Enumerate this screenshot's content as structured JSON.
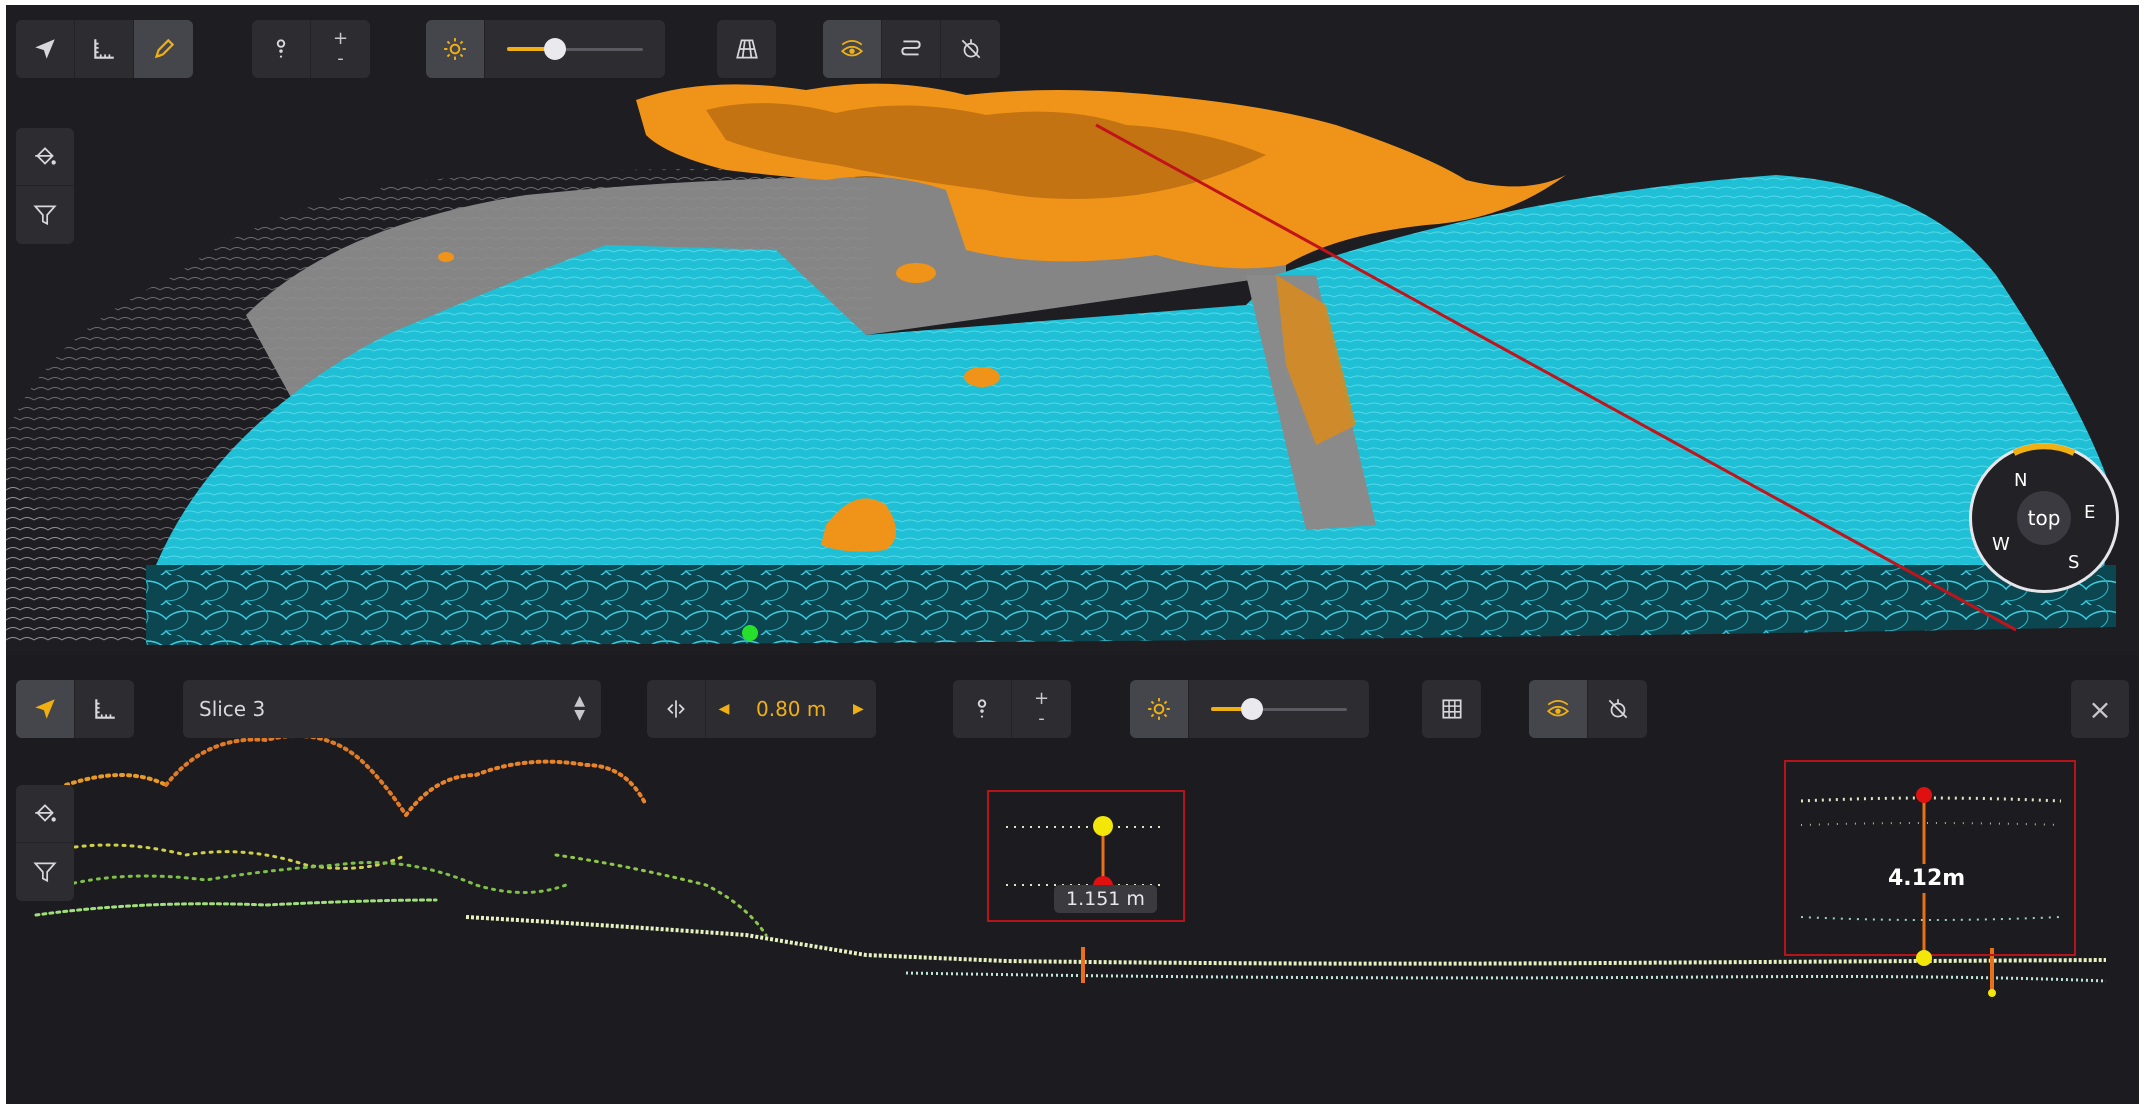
{
  "top_view": {
    "toolbar": {
      "navigate_icon": "navigate-arrow-icon",
      "measure_icon": "ruler-icon",
      "draw_icon": "pencil-icon",
      "point_size_plus": "+",
      "point_size_minus": "-",
      "brightness_icon": "sun-icon",
      "brightness_level": 0.35,
      "grid_icon": "grid-3d-icon",
      "visibility_icon": "eye-layers-icon",
      "slice_icon": "slice-path-icon",
      "crosshair_icon": "no-target-icon"
    },
    "side_tools": [
      "paint-bucket-icon",
      "filter-icon"
    ],
    "compass": {
      "north": "N",
      "east": "E",
      "south": "S",
      "west": "W",
      "center_label": "top"
    }
  },
  "bottom_view": {
    "toolbar": {
      "slice_select_value": "Slice 3",
      "slice_width_value": "0.80 m",
      "point_size_plus": "+",
      "point_size_minus": "-",
      "brightness_level": 0.3,
      "close_label": "×"
    },
    "side_tools": [
      "paint-bucket-icon",
      "filter-icon"
    ],
    "measurements": [
      {
        "label": "1.151 m"
      },
      {
        "label": "4.12m"
      }
    ]
  },
  "colors": {
    "accent": "#f0b012",
    "panel": "#2c2c31",
    "background": "#1c1c20",
    "cyan_points": "#20c4d8",
    "orange_points": "#f09a1a",
    "gray_points": "#8a8a8a",
    "measure_box": "#b5141a"
  }
}
